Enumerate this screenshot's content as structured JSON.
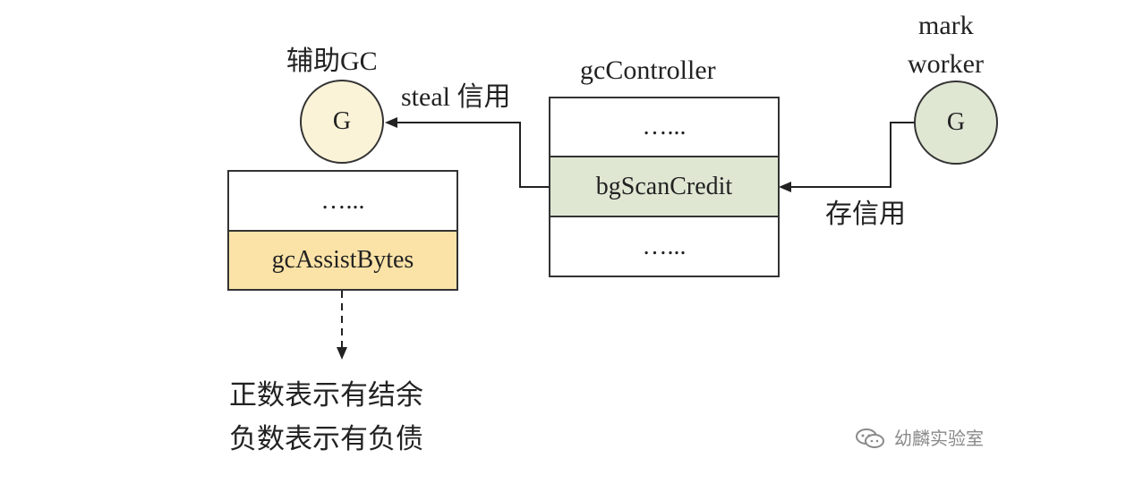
{
  "colors": {
    "assist_g_fill": "#fbf3d8",
    "worker_g_fill": "#dfe7d3",
    "bgscancredit_fill": "#dfe7d3",
    "gcassistbytes_fill": "#fbe3a7",
    "stroke": "#333333"
  },
  "assist_gc": {
    "label": "辅助GC",
    "node": "G"
  },
  "mark_worker": {
    "label_line1": "mark",
    "label_line2": "worker",
    "node": "G"
  },
  "gc_controller": {
    "title": "gcController",
    "cells": [
      "…...",
      "bgScanCredit",
      "…..."
    ]
  },
  "g_struct": {
    "cells": [
      "…...",
      "gcAssistBytes"
    ]
  },
  "edges": {
    "steal_label": "steal 信用",
    "deposit_label": "存信用"
  },
  "note": {
    "line1": "正数表示有结余",
    "line2": "负数表示有负债"
  },
  "watermark": {
    "icon": "wechat-icon",
    "text": "幼麟实验室"
  }
}
